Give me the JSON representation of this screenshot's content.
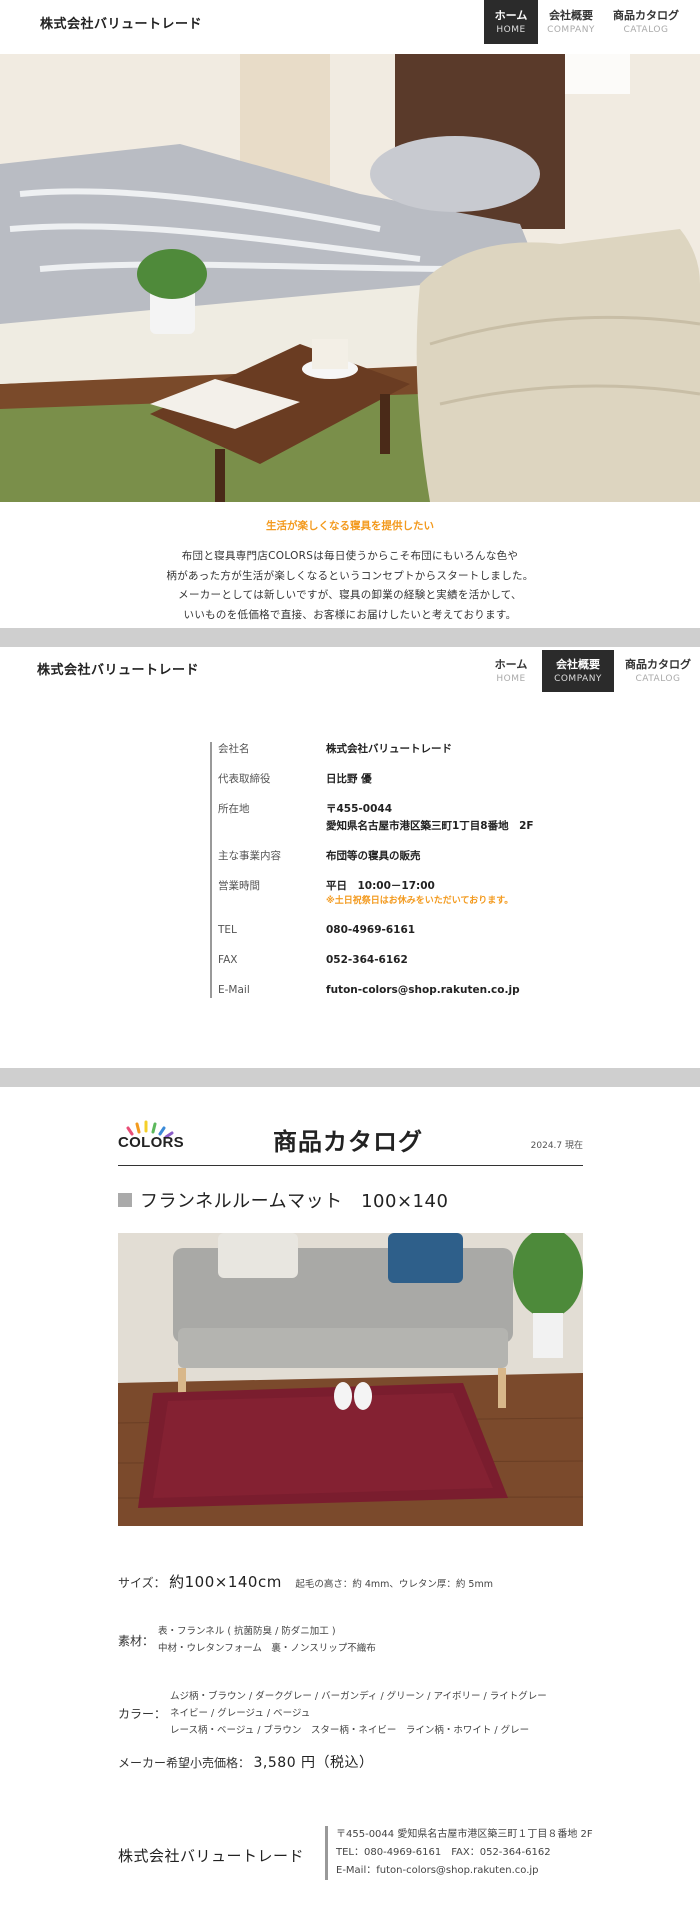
{
  "company_name": "株式会社バリュートレード",
  "nav": [
    {
      "jp": "ホーム",
      "en": "HOME"
    },
    {
      "jp": "会社概要",
      "en": "COMPANY"
    },
    {
      "jp": "商品カタログ",
      "en": "CATALOG"
    }
  ],
  "intro": {
    "lead": "生活が楽しくなる寝具を提供したい",
    "lines": [
      "布団と寝具専門店COLORSは毎日使うからこそ布団にもいろんな色や",
      "柄があった方が生活が楽しくなるというコンセプトからスタートしました。",
      "メーカーとしては新しいですが、寝具の卸業の経験と実績を活かして、",
      "いいものを低価格で直接、お客様にお届けしたいと考えております。"
    ]
  },
  "company_table": [
    {
      "key": "会社名",
      "value": "株式会社バリュートレード"
    },
    {
      "key": "代表取締役",
      "value": "日比野 優"
    },
    {
      "key": "所在地",
      "value": "〒455-0044",
      "value2": "愛知県名古屋市港区築三町1丁目8番地　2F"
    },
    {
      "key": "主な事業内容",
      "value": "布団等の寝具の販売"
    },
    {
      "key": "営業時間",
      "value": "平日　10:00－17:00",
      "note": "※土日祝祭日はお休みをいただいております。"
    },
    {
      "key": "TEL",
      "value": "080-4969-6161"
    },
    {
      "key": "FAX",
      "value": "052-364-6162"
    },
    {
      "key": "E-Mail",
      "value": "futon-colors@shop.rakuten.co.jp"
    }
  ],
  "catalog": {
    "brand": "COLORS",
    "title": "商品カタログ",
    "date": "2024.7 現在",
    "product_title": "フランネルルームマット　100×140",
    "size_label": "サイズ：",
    "size_value": "約100×140cm",
    "size_note": "起毛の高さ：約 4mm、ウレタン厚：約 5mm",
    "material_label": "素材：",
    "material_lines": [
      "表・フランネル ( 抗菌防臭 / 防ダニ加工 )",
      "中材・ウレタンフォーム　裏・ノンスリップ不織布"
    ],
    "color_label": "カラー：",
    "color_lines": [
      "ムジ柄・ブラウン / ダークグレー / バーガンディ / グリーン / アイボリー / ライトグレー",
      "ネイビー / グレージュ / ベージュ",
      "レース柄・ベージュ / ブラウン　スター柄・ネイビー　ライン柄・ホワイト / グレー"
    ],
    "price_label": "メーカー希望小売価格：",
    "price_value": "3,580 円（税込）"
  },
  "footer": {
    "name": "株式会社バリュートレード",
    "address": "〒455-0044 愛知県名古屋市港区築三町１丁目８番地 2F",
    "telfax": "TEL：080-4969-6161　FAX：052-364-6162",
    "email": "E-Mail：futon-colors@shop.rakuten.co.jp"
  },
  "colors": {
    "accent": "#f39a1e",
    "nav_active": "#2b2b2b",
    "band": "#cfcfcf"
  }
}
